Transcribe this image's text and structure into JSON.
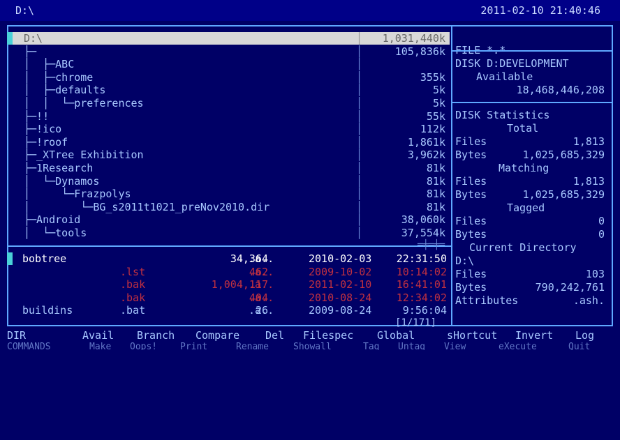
{
  "top": {
    "path": "D:\\",
    "clock": "2011-02-10 21:40:46"
  },
  "tree": [
    {
      "name": "D:\\",
      "size": "1,031,440k",
      "selected": true
    },
    {
      "name": "├─",
      "size": "105,836k"
    },
    {
      "name": "│  ├─ABC",
      "size": ""
    },
    {
      "name": "│  ├─chrome",
      "size": "355k"
    },
    {
      "name": "│  ├─defaults",
      "size": "5k"
    },
    {
      "name": "│  │  └─preferences",
      "size": "5k"
    },
    {
      "name": "├─!!",
      "size": "55k"
    },
    {
      "name": "├─!ico",
      "size": "112k"
    },
    {
      "name": "├─!roof",
      "size": "1,861k"
    },
    {
      "name": "├─_XTree Exhibition",
      "size": "3,962k"
    },
    {
      "name": "├─1Research",
      "size": "81k"
    },
    {
      "name": "│  └─Dynamos",
      "size": "81k"
    },
    {
      "name": "│     └─Frazpolys",
      "size": "81k"
    },
    {
      "name": "│        └─BG_s2011t1021_preNov2010.dir",
      "size": "81k"
    },
    {
      "name": "├─Android",
      "size": "38,060k"
    },
    {
      "name": "│  └─tools",
      "size": "37,554k"
    }
  ],
  "files": [
    {
      "name": "bobtree",
      "ext": "",
      "size": "34,364",
      "attr": ".a..",
      "date": "2010-02-03",
      "time": "22:31:50",
      "style": "hl"
    },
    {
      "name": "",
      "ext": ".lst",
      "size": "462",
      "attr": ".a..",
      "date": "2009-10-02",
      "time": "10:14:02",
      "style": "red"
    },
    {
      "name": "",
      "ext": ".bak",
      "size": "1,004,117",
      "attr": ".a..",
      "date": "2011-02-10",
      "time": "16:41:01",
      "style": "red"
    },
    {
      "name": "",
      "ext": ".bak",
      "size": "404",
      "attr": ".a..",
      "date": "2010-08-24",
      "time": "12:34:02",
      "style": "red"
    },
    {
      "name": "buildins",
      "ext": ".bat",
      "size": "26",
      "attr": ".a..",
      "date": "2009-08-24",
      "time": "9:56:04",
      "style": ""
    }
  ],
  "file_counter": "1/171",
  "right": {
    "filespec": "FILE *.*",
    "disk_label": "DISK D:DEVELOPMENT",
    "available_label": "Available",
    "available_bytes": "18,468,446,208",
    "stats_title": "DISK Statistics",
    "total_label": "Total",
    "total_files": "1,813",
    "total_bytes": "1,025,685,329",
    "matching_label": "Matching",
    "matching_files": "1,813",
    "matching_bytes": "1,025,685,329",
    "tagged_label": "Tagged",
    "tagged_files": "0",
    "tagged_bytes": "0",
    "curdir_label": "Current Directory",
    "curdir_path": "D:\\",
    "cur_files": "103",
    "cur_bytes": "790,242,761",
    "attributes_label": "Attributes",
    "attributes_value": ".ash.",
    "files_label": "Files",
    "bytes_label": "Bytes"
  },
  "menu": [
    "DIR",
    "Avail",
    "Branch",
    "Compare",
    "Del",
    "Filespec",
    "Global",
    "sHortcut",
    "Invert",
    "Log"
  ],
  "menu2": [
    "COMMANDS",
    "Make",
    "Oops!",
    "Print",
    "Rename",
    "Showall",
    "Tag",
    "Untag",
    "View",
    "eXecute",
    "Quit"
  ]
}
